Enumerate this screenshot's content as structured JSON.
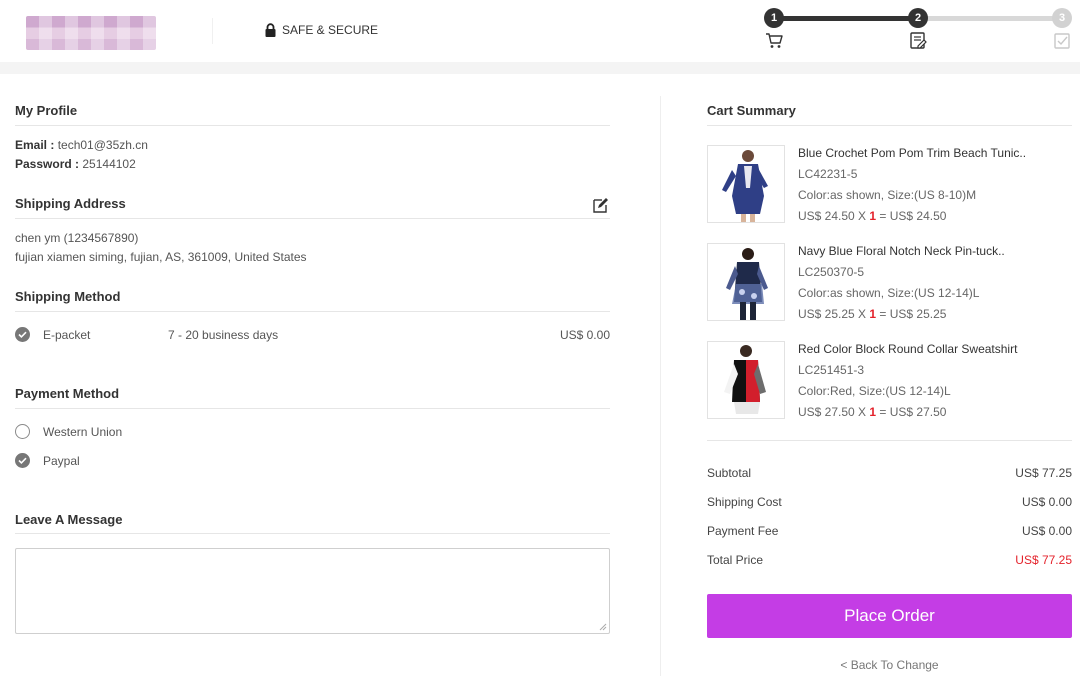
{
  "header": {
    "secure_label": "SAFE & SECURE",
    "steps": [
      "1",
      "2",
      "3"
    ]
  },
  "profile": {
    "title": "My Profile",
    "email_label": "Email :",
    "email_value": "tech01@35zh.cn",
    "password_label": "Password :",
    "password_value": "25144102"
  },
  "shipping_address": {
    "title": "Shipping Address",
    "name_phone": "chen ym (1234567890)",
    "address": "fujian xiamen siming, fujian, AS, 361009, United States"
  },
  "shipping_method": {
    "title": "Shipping Method",
    "name": "E-packet",
    "days": "7 - 20 business days",
    "price": "US$ 0.00"
  },
  "payment_method": {
    "title": "Payment Method",
    "options": [
      "Western Union",
      "Paypal"
    ],
    "selected": "Paypal"
  },
  "message": {
    "title": "Leave A Message"
  },
  "cart": {
    "title": "Cart Summary",
    "items": [
      {
        "name": "Blue Crochet Pom Pom Trim Beach Tunic..",
        "sku": "LC42231-5",
        "options": "Color:as shown, Size:(US 8-10)M",
        "price": "US$ 24.50 X ",
        "qty": "1",
        "total": " = US$ 24.50"
      },
      {
        "name": "Navy Blue Floral Notch Neck Pin-tuck..",
        "sku": "LC250370-5",
        "options": "Color:as shown, Size:(US 12-14)L",
        "price": "US$ 25.25 X ",
        "qty": "1",
        "total": " = US$ 25.25"
      },
      {
        "name": "Red Color Block Round Collar Sweatshirt",
        "sku": "LC251451-3",
        "options": "Color:Red, Size:(US 12-14)L",
        "price": "US$ 27.50 X ",
        "qty": "1",
        "total": " = US$ 27.50"
      }
    ],
    "summary": {
      "subtotal_label": "Subtotal",
      "subtotal_value": "US$  77.25",
      "shipping_label": "Shipping Cost",
      "shipping_value": "US$  0.00",
      "payment_label": "Payment Fee",
      "payment_value": "US$  0.00",
      "total_label": "Total Price",
      "total_value": "US$  77.25"
    },
    "place_order_label": "Place Order",
    "back_label": "< Back To Change"
  },
  "colors": {
    "accent": "#c43de5",
    "price_red": "#e4222b"
  }
}
